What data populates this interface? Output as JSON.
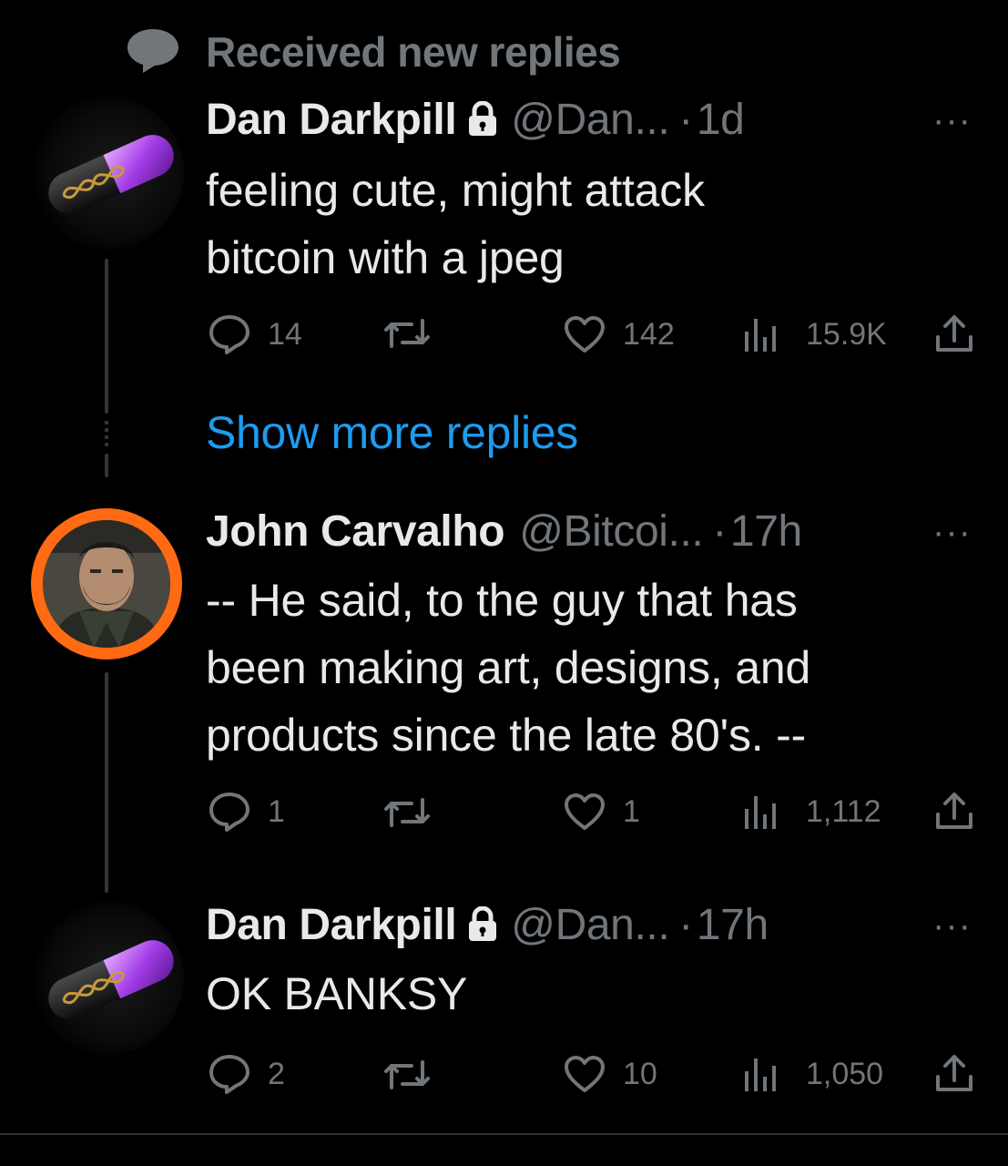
{
  "context": {
    "label": "Received new replies",
    "icon": "speech-bubble-icon"
  },
  "show_more": "Show more replies",
  "tweets": [
    {
      "name": "Dan Darkpill",
      "handle": "@Dan...",
      "sep": "·",
      "time": "1d",
      "locked": true,
      "text": [
        "feeling cute, might attack",
        "bitcoin with a jpeg"
      ],
      "reply_count": "14",
      "retweet_count": "",
      "like_count": "142",
      "view_count": "15.9K",
      "more": "···"
    },
    {
      "name": "John Carvalho",
      "handle": "@Bitcoi...",
      "sep": "·",
      "time": "17h",
      "locked": false,
      "text": [
        "-- He said, to the guy that has",
        "been making art, designs, and",
        "products since the late 80's. --"
      ],
      "reply_count": "1",
      "retweet_count": "",
      "like_count": "1",
      "view_count": "1,112",
      "more": "···"
    },
    {
      "name": "Dan Darkpill",
      "handle": "@Dan...",
      "sep": "·",
      "time": "17h",
      "locked": true,
      "text": [
        "OK BANKSY"
      ],
      "reply_count": "2",
      "retweet_count": "",
      "like_count": "10",
      "view_count": "1,050",
      "more": "···"
    }
  ],
  "colors": {
    "accent": "#1d9bf0",
    "muted": "#71767b",
    "text": "#e7e9ea",
    "avatar_ring": "#ff6a13"
  }
}
